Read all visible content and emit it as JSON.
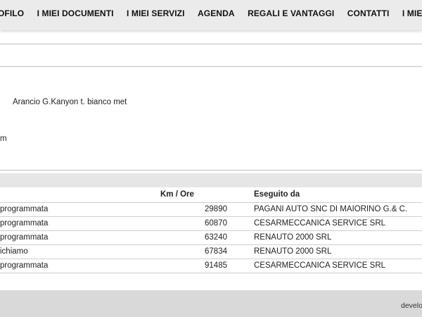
{
  "nav": {
    "items": [
      {
        "label": "OFILO"
      },
      {
        "label": "I MIEI DOCUMENTI"
      },
      {
        "label": "I MIEI SERVIZI"
      },
      {
        "label": "AGENDA"
      },
      {
        "label": "REGALI E VANTAGGI"
      },
      {
        "label": "CONTATTI"
      },
      {
        "label": "I MIEI ORDINI"
      }
    ]
  },
  "vehicle": {
    "color_value": "Arancio G.Kanyon t. bianco met",
    "partial_text": "m"
  },
  "services": {
    "headers": {
      "km": "Km / Ore",
      "by": "Eseguito da"
    },
    "rows": [
      {
        "type": "programmata",
        "km": "29890",
        "by": "PAGANI AUTO SNC DI MAIORINO G.& C."
      },
      {
        "type": "programmata",
        "km": "60870",
        "by": "CESARMECCANICA SERVICE SRL"
      },
      {
        "type": "programmata",
        "km": "63240",
        "by": "RENAUTO 2000 SRL"
      },
      {
        "type": "ichiamo",
        "km": "67834",
        "by": "RENAUTO 2000 SRL"
      },
      {
        "type": "programmata",
        "km": "91485",
        "by": "CESARMECCANICA SERVICE SRL"
      }
    ]
  },
  "footer": {
    "credit": "develo"
  }
}
